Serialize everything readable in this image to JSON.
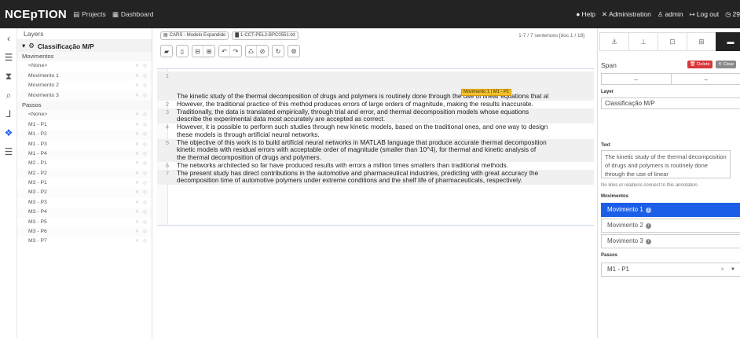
{
  "topbar": {
    "brand": "NCEpTION",
    "nav": [
      {
        "icon": "projects-icon",
        "label": "Projects"
      },
      {
        "icon": "dashboard-icon",
        "label": "Dashboard"
      }
    ],
    "right": {
      "help": "Help",
      "administration": "Administration",
      "user": "admin",
      "logout": "Log out",
      "timer": "29"
    }
  },
  "sidebar": {
    "title": "Layers",
    "layer": "Classificação M/P",
    "groups": [
      {
        "label": "Movimentos",
        "items": [
          "<None>",
          "Movimento 1",
          "Movimento 2",
          "Movimento 3"
        ]
      },
      {
        "label": "Passos",
        "items": [
          "<None>",
          "M1 - P1",
          "M1 - P2",
          "M1 - P3",
          "M1 - P4",
          "M2 - P1",
          "M2 - P2",
          "M3 - P1",
          "M3 - P2",
          "M3 - P3",
          "M3 - P4",
          "M3 - P5",
          "M3 - P6",
          "M3 - P7"
        ]
      }
    ]
  },
  "document": {
    "project": "CARS - Modelo Expandido",
    "filename": "1-CCT-PEL2-BPC0551.txt",
    "sentence_counter": "1-7 / 7 sentences [doc 1 / 18]",
    "annotation_label": "Movimento 1 | M1 - P1",
    "sentences": [
      {
        "num": "1",
        "lines": [
          "The kinetic study of the thermal decomposition of drugs and polymers is routinely done through the use of linear equations that al"
        ]
      },
      {
        "num": "2",
        "lines": [
          "However, the traditional practice of this method produces errors of large orders of magnitude, making the results inaccurate."
        ]
      },
      {
        "num": "3",
        "lines": [
          "Traditionally, the data is translated empirically, through trial and error, and thermal decomposition models whose equations",
          "describe the experimental data most accurately are accepted as correct."
        ]
      },
      {
        "num": "4",
        "lines": [
          "However, it is possible to perform such studies through new kinetic models, based on the traditional ones, and one way to design",
          "these models is through artificial neural networks."
        ]
      },
      {
        "num": "5",
        "lines": [
          "The objective of this work is to build artificial neural networks in MATLAB language that produce accurate thermal decomposition",
          "kinetic models with residual errors with acceptable order of magnitude (smaller than 10^4), for thermal and kinetic analysis of",
          "the thermal decomposition of drugs and polymers."
        ]
      },
      {
        "num": "6",
        "lines": [
          "The networks architected so far have produced results with errors a million times smallers than traditional methods."
        ]
      },
      {
        "num": "7",
        "lines": [
          "The present study has direct contributions in the automotive and pharmaceutical industries, predicting with great accuracy the",
          "decomposition time of automotive polymers under extreme conditions and the shelf life of pharmaceuticals, respectively."
        ]
      }
    ]
  },
  "right_panel": {
    "section_title": "Span",
    "delete_label": "Delete",
    "clear_label": "Clear",
    "prev_arrow": "←",
    "next_arrow": "→",
    "layer_label": "Layer",
    "layer_value": "Classificação M/P",
    "text_label": "Text",
    "text_value": "The kinetic study of the thermal decomposition of drugs and polymers is routinely done through the use of linear",
    "no_links": "No links or relations connect to this annotation.",
    "movimentos_label": "Movimentos",
    "movimentos": [
      "Movimento 1",
      "Movimento 2",
      "Movimento 3"
    ],
    "movimentos_selected": "Movimento 1",
    "passos_label": "Passos",
    "passos_value": "M1 - P1"
  },
  "colors": {
    "topbar": "#232323",
    "selected": "#1d5ee8",
    "annotation": "#f0c030",
    "delete": "#d9383a"
  }
}
